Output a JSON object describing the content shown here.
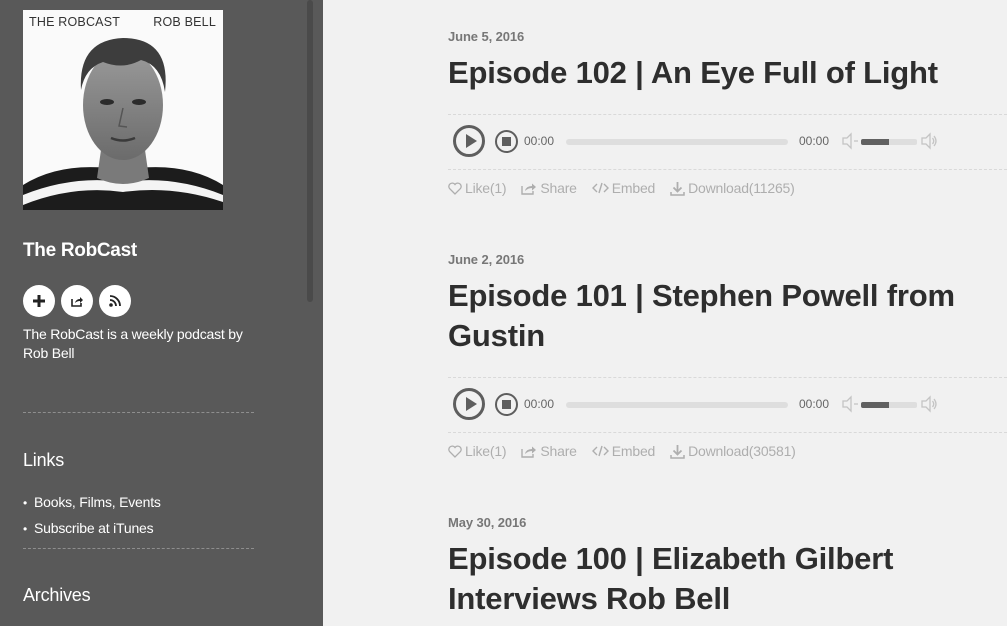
{
  "sidebar": {
    "cover": {
      "title_left": "THE ROBCAST",
      "title_right": "ROB BELL"
    },
    "podcast_title": "The RobCast",
    "buttons": [
      {
        "icon": "plus-icon"
      },
      {
        "icon": "share-icon"
      },
      {
        "icon": "rss-icon"
      }
    ],
    "description": "The RobCast is a weekly podcast by Rob Bell",
    "links_heading": "Links",
    "links": [
      "Books, Films, Events",
      "Subscribe at iTunes"
    ],
    "archives_heading": "Archives"
  },
  "episodes": [
    {
      "date": "June 5, 2016",
      "title": "Episode 102 | An Eye Full of Light",
      "time_elapsed": "00:00",
      "time_total": "00:00",
      "volume": 0.5,
      "like_label": "Like(1)",
      "share_label": "Share",
      "embed_label": "Embed",
      "download_label": "Download(11265)"
    },
    {
      "date": "June 2, 2016",
      "title": "Episode 101 | Stephen Powell from Gustin",
      "time_elapsed": "00:00",
      "time_total": "00:00",
      "volume": 0.5,
      "like_label": "Like(1)",
      "share_label": "Share",
      "embed_label": "Embed",
      "download_label": "Download(30581)"
    },
    {
      "date": "May 30, 2016",
      "title": "Episode 100 | Elizabeth Gilbert Interviews Rob Bell"
    }
  ],
  "colors": {
    "sidebar_bg": "#595959",
    "page_bg": "#f1f1f1",
    "title_text": "#2e2e2e",
    "action_text": "#aeaeae"
  }
}
